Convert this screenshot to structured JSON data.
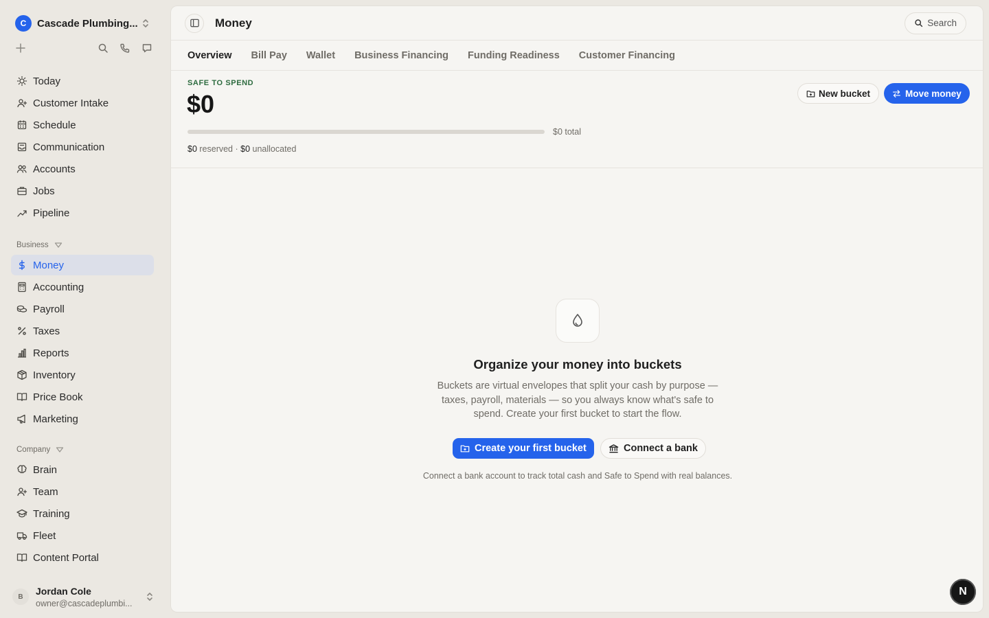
{
  "workspace": {
    "logo_letter": "C",
    "name": "Cascade Plumbing..."
  },
  "nav_main": [
    {
      "label": "Today",
      "icon": "sun-icon"
    },
    {
      "label": "Customer Intake",
      "icon": "user-plus-icon"
    },
    {
      "label": "Schedule",
      "icon": "calendar-icon"
    },
    {
      "label": "Communication",
      "icon": "inbox-icon"
    },
    {
      "label": "Accounts",
      "icon": "users-icon"
    },
    {
      "label": "Jobs",
      "icon": "briefcase-icon"
    },
    {
      "label": "Pipeline",
      "icon": "trend-icon"
    }
  ],
  "section_business": {
    "label": "Business"
  },
  "nav_business": [
    {
      "label": "Money",
      "icon": "dollar-icon",
      "active": true
    },
    {
      "label": "Accounting",
      "icon": "calculator-icon"
    },
    {
      "label": "Payroll",
      "icon": "coins-icon"
    },
    {
      "label": "Taxes",
      "icon": "percent-icon"
    },
    {
      "label": "Reports",
      "icon": "bar-chart-icon"
    },
    {
      "label": "Inventory",
      "icon": "package-icon"
    },
    {
      "label": "Price Book",
      "icon": "book-open-icon"
    },
    {
      "label": "Marketing",
      "icon": "megaphone-icon"
    }
  ],
  "section_company": {
    "label": "Company"
  },
  "nav_company": [
    {
      "label": "Brain",
      "icon": "brain-icon"
    },
    {
      "label": "Team",
      "icon": "user-plus-icon"
    },
    {
      "label": "Training",
      "icon": "graduation-cap-icon"
    },
    {
      "label": "Fleet",
      "icon": "truck-icon"
    },
    {
      "label": "Content Portal",
      "icon": "book-open-icon"
    }
  ],
  "user": {
    "initial": "B",
    "name": "Jordan Cole",
    "email": "owner@cascadeplumbi..."
  },
  "header": {
    "title": "Money",
    "search_label": "Search"
  },
  "tabs": [
    {
      "label": "Overview",
      "active": true
    },
    {
      "label": "Bill Pay"
    },
    {
      "label": "Wallet"
    },
    {
      "label": "Business Financing"
    },
    {
      "label": "Funding Readiness"
    },
    {
      "label": "Customer Financing"
    }
  ],
  "summary": {
    "label": "SAFE TO SPEND",
    "amount": "$0",
    "progress": 0,
    "total": "$0 total",
    "reserved_amount": "$0",
    "reserved_label": " reserved · ",
    "unallocated_amount": "$0",
    "unallocated_label": " unallocated",
    "new_bucket_label": "New bucket",
    "move_money_label": "Move money"
  },
  "empty_state": {
    "title": "Organize your money into buckets",
    "description": "Buckets are virtual envelopes that split your cash by purpose — taxes, payroll, materials — so you always know what's safe to spend. Create your first bucket to start the flow.",
    "create_label": "Create your first bucket",
    "connect_label": "Connect a bank",
    "note": "Connect a bank account to track total cash and Safe to Spend with real balances."
  },
  "fab": {
    "label": "N"
  },
  "colors": {
    "accent": "#2563eb",
    "safe_label": "#2d6b3f"
  }
}
